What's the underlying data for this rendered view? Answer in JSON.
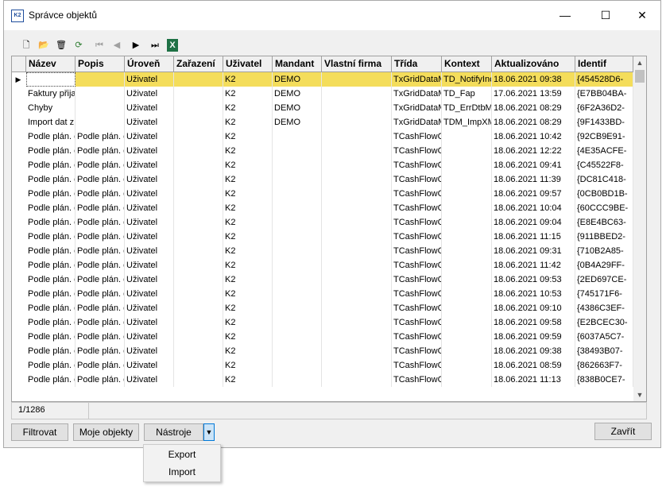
{
  "window": {
    "title": "Správce objektů",
    "app_icon_text": "K2",
    "minimize": "—",
    "maximize": "☐",
    "close": "✕"
  },
  "toolbar": {
    "new": "🗋",
    "open": "📂",
    "delete": "🗑",
    "refresh": "⟳",
    "first": "⏮",
    "prev": "◀",
    "next": "▶",
    "last": "⏭",
    "excel": "X"
  },
  "grid": {
    "columns": [
      "Název",
      "Popis",
      "Úroveň",
      "Zařazení",
      "Uživatel",
      "Mandant",
      "Vlastní firma",
      "Třída",
      "Kontext",
      "Aktualizováno",
      "Identif"
    ],
    "rows": [
      [
        "",
        "",
        "Uživatel",
        "",
        "K2",
        "DEMO",
        "",
        "TxGridDataM",
        "TD_NotifyInc",
        "18.06.2021 09:38",
        "{454528D6-"
      ],
      [
        "Faktury přija",
        "",
        "Uživatel",
        "",
        "K2",
        "DEMO",
        "",
        "TxGridDataM",
        "TD_Fap",
        "17.06.2021 13:59",
        "{E7BB04BA-"
      ],
      [
        "Chyby",
        "",
        "Uživatel",
        "",
        "K2",
        "DEMO",
        "",
        "TxGridDataM",
        "TD_ErrDtbMo",
        "18.06.2021 08:29",
        "{6F2A36D2-"
      ],
      [
        "Import dat z",
        "",
        "Uživatel",
        "",
        "K2",
        "DEMO",
        "",
        "TxGridDataM",
        "TDM_ImpXML",
        "18.06.2021 08:29",
        "{9F1433BD-"
      ],
      [
        "Podle plán. c",
        "Podle plán. c",
        "Uživatel",
        "",
        "K2",
        "",
        "",
        "TCashFlowC",
        "",
        "18.06.2021 10:42",
        "{92CB9E91-"
      ],
      [
        "Podle plán. c",
        "Podle plán. c",
        "Uživatel",
        "",
        "K2",
        "",
        "",
        "TCashFlowC",
        "",
        "18.06.2021 12:22",
        "{4E35ACFE-"
      ],
      [
        "Podle plán. c",
        "Podle plán. c",
        "Uživatel",
        "",
        "K2",
        "",
        "",
        "TCashFlowC",
        "",
        "18.06.2021 09:41",
        "{C45522F8-"
      ],
      [
        "Podle plán. c",
        "Podle plán. c",
        "Uživatel",
        "",
        "K2",
        "",
        "",
        "TCashFlowC",
        "",
        "18.06.2021 11:39",
        "{DC81C418-"
      ],
      [
        "Podle plán. c",
        "Podle plán. c",
        "Uživatel",
        "",
        "K2",
        "",
        "",
        "TCashFlowC",
        "",
        "18.06.2021 09:57",
        "{0CB0BD1B-"
      ],
      [
        "Podle plán. c",
        "Podle plán. c",
        "Uživatel",
        "",
        "K2",
        "",
        "",
        "TCashFlowC",
        "",
        "18.06.2021 10:04",
        "{60CCC9BE-"
      ],
      [
        "Podle plán. c",
        "Podle plán. c",
        "Uživatel",
        "",
        "K2",
        "",
        "",
        "TCashFlowC",
        "",
        "18.06.2021 09:04",
        "{E8E4BC63-"
      ],
      [
        "Podle plán. c",
        "Podle plán. c",
        "Uživatel",
        "",
        "K2",
        "",
        "",
        "TCashFlowC",
        "",
        "18.06.2021 11:15",
        "{911BBED2-"
      ],
      [
        "Podle plán. c",
        "Podle plán. c",
        "Uživatel",
        "",
        "K2",
        "",
        "",
        "TCashFlowC",
        "",
        "18.06.2021 09:31",
        "{710B2A85-"
      ],
      [
        "Podle plán. c",
        "Podle plán. c",
        "Uživatel",
        "",
        "K2",
        "",
        "",
        "TCashFlowC",
        "",
        "18.06.2021 11:42",
        "{0B4A29FF-"
      ],
      [
        "Podle plán. c",
        "Podle plán. c",
        "Uživatel",
        "",
        "K2",
        "",
        "",
        "TCashFlowC",
        "",
        "18.06.2021 09:53",
        "{2ED697CE-"
      ],
      [
        "Podle plán. c",
        "Podle plán. c",
        "Uživatel",
        "",
        "K2",
        "",
        "",
        "TCashFlowC",
        "",
        "18.06.2021 10:53",
        "{745171F6-"
      ],
      [
        "Podle plán. c",
        "Podle plán. c",
        "Uživatel",
        "",
        "K2",
        "",
        "",
        "TCashFlowC",
        "",
        "18.06.2021 09:10",
        "{4386C3EF-"
      ],
      [
        "Podle plán. c",
        "Podle plán. c",
        "Uživatel",
        "",
        "K2",
        "",
        "",
        "TCashFlowC",
        "",
        "18.06.2021 09:58",
        "{E2BCEC30-"
      ],
      [
        "Podle plán. c",
        "Podle plán. c",
        "Uživatel",
        "",
        "K2",
        "",
        "",
        "TCashFlowC",
        "",
        "18.06.2021 09:59",
        "{6037A5C7-"
      ],
      [
        "Podle plán. c",
        "Podle plán. c",
        "Uživatel",
        "",
        "K2",
        "",
        "",
        "TCashFlowC",
        "",
        "18.06.2021 09:38",
        "{38493B07-"
      ],
      [
        "Podle plán. c",
        "Podle plán. c",
        "Uživatel",
        "",
        "K2",
        "",
        "",
        "TCashFlowC",
        "",
        "18.06.2021 08:59",
        "{862663F7-"
      ],
      [
        "Podle plán. c",
        "Podle plán. c",
        "Uživatel",
        "",
        "K2",
        "",
        "",
        "TCashFlowC",
        "",
        "18.06.2021 11:13",
        "{838B0CE7-"
      ]
    ],
    "selected_row": 0,
    "selected_color": "#f4dd5b"
  },
  "status": {
    "record_count": "1/1286"
  },
  "buttons": {
    "filter": "Filtrovat",
    "my_objects": "Moje objekty",
    "tools": "Nástroje",
    "close": "Zavřít"
  },
  "tools_menu": {
    "items": [
      "Export",
      "Import"
    ]
  }
}
